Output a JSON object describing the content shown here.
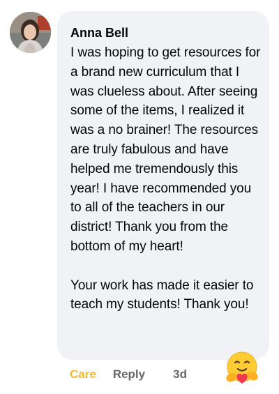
{
  "comment": {
    "author": "Anna Bell",
    "text": "I was hoping to get resources for a brand new curriculum that I was clueless about. After seeing some of the items, I realized it was a no brainer! The resources are truly fabulous and have helped me tremendously this year! I have recommended you to all of the teachers in our district! Thank you from the bottom of my heart!\n\nYour work has made it easier to teach my students! Thank you!"
  },
  "actions": {
    "care_label": "Care",
    "reply_label": "Reply",
    "timestamp": "3d"
  },
  "reaction": {
    "icon": "care-hug-emoji-icon"
  },
  "colors": {
    "care": "#f7b928",
    "secondary": "#65676b",
    "bubble": "#f0f2f5"
  }
}
